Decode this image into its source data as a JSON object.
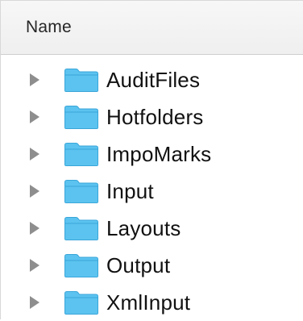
{
  "header": {
    "name_label": "Name"
  },
  "folder_icon_color": "#5cc3f0",
  "items": [
    {
      "label": "AuditFiles"
    },
    {
      "label": "Hotfolders"
    },
    {
      "label": "ImpoMarks"
    },
    {
      "label": "Input"
    },
    {
      "label": "Layouts"
    },
    {
      "label": "Output"
    },
    {
      "label": "XmlInput"
    }
  ]
}
